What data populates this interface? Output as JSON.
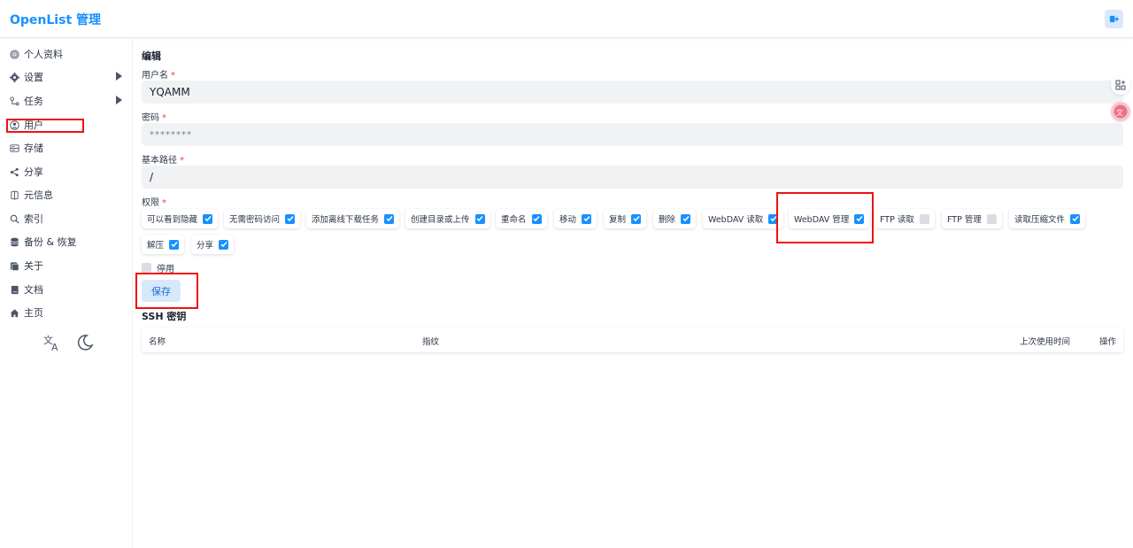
{
  "header": {
    "title": "OpenList 管理"
  },
  "sidebar": {
    "items": [
      {
        "label": "个人资料",
        "icon": "fingerprint-icon"
      },
      {
        "label": "设置",
        "icon": "gear-icon"
      },
      {
        "label": "任务",
        "icon": "tasks-icon"
      },
      {
        "label": "用户",
        "icon": "user-icon"
      },
      {
        "label": "存储",
        "icon": "storage-icon"
      },
      {
        "label": "分享",
        "icon": "share-icon"
      },
      {
        "label": "元信息",
        "icon": "meta-icon"
      },
      {
        "label": "索引",
        "icon": "search-icon"
      },
      {
        "label": "备份 & 恢复",
        "icon": "database-icon"
      },
      {
        "label": "关于",
        "icon": "about-icon"
      },
      {
        "label": "文档",
        "icon": "book-icon"
      },
      {
        "label": "主页",
        "icon": "home-icon"
      }
    ]
  },
  "form": {
    "section_title": "编辑",
    "username_label": "用户名",
    "username_value": "YQAMM",
    "password_label": "密码",
    "password_value": "********",
    "base_path_label": "基本路径",
    "base_path_value": "/",
    "permissions_label": "权限",
    "required_mark": "*",
    "permissions": [
      {
        "label": "可以看到隐藏",
        "checked": true
      },
      {
        "label": "无需密码访问",
        "checked": true
      },
      {
        "label": "添加离线下载任务",
        "checked": true
      },
      {
        "label": "创建目录或上传",
        "checked": true
      },
      {
        "label": "重命名",
        "checked": true
      },
      {
        "label": "移动",
        "checked": true
      },
      {
        "label": "复制",
        "checked": true
      },
      {
        "label": "删除",
        "checked": true
      },
      {
        "label": "WebDAV 读取",
        "checked": true
      },
      {
        "label": "WebDAV 管理",
        "checked": true
      },
      {
        "label": "FTP 读取",
        "checked": false
      },
      {
        "label": "FTP 管理",
        "checked": false
      },
      {
        "label": "读取压缩文件",
        "checked": true
      },
      {
        "label": "解压",
        "checked": true
      },
      {
        "label": "分享",
        "checked": true
      }
    ],
    "disable_label": "停用",
    "disable_checked": false,
    "save_label": "保存"
  },
  "ssh": {
    "title": "SSH 密钥",
    "columns": [
      "名称",
      "指纹",
      "上次使用时间",
      "操作"
    ]
  },
  "colors": {
    "accent": "#1890ff",
    "highlight_box": "#ee1111"
  }
}
